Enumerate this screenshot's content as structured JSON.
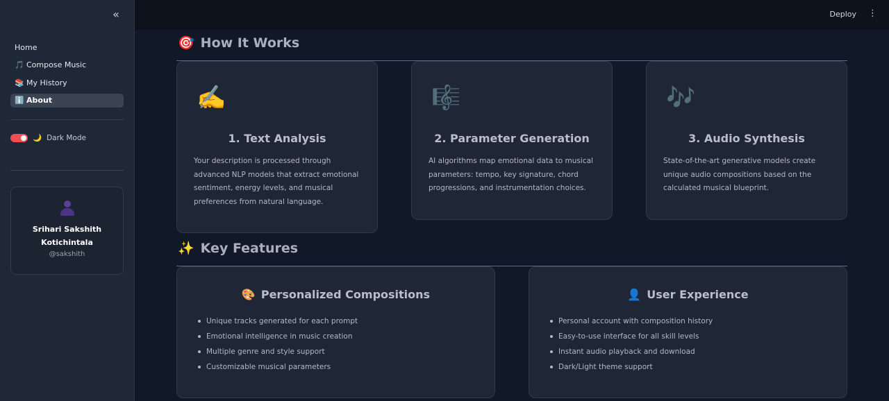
{
  "sidebar": {
    "collapse_icon": "chevrons-left-icon",
    "nav": [
      {
        "label": "Home",
        "icon": ""
      },
      {
        "label": "Compose Music",
        "icon": "🎵"
      },
      {
        "label": "My History",
        "icon": "📚"
      },
      {
        "label": "About",
        "icon": "ℹ️",
        "active": true
      }
    ],
    "dark_mode": {
      "label": "Dark Mode",
      "icon": "🌙",
      "on": true
    },
    "profile": {
      "name_line1": "Srihari Sakshith",
      "name_line2": "Kotichintala",
      "handle": "@sakshith"
    }
  },
  "topbar": {
    "deploy_label": "Deploy",
    "menu_icon": "kebab-icon"
  },
  "how_it_works": {
    "icon": "🎯",
    "title": "How It Works",
    "cards": [
      {
        "icon": "✍️",
        "title": "1. Text Analysis",
        "text": "Your description is processed through advanced NLP models that extract emotional sentiment, energy levels, and musical preferences from natural language."
      },
      {
        "icon": "🎼",
        "title": "2. Parameter Generation",
        "text": "AI algorithms map emotional data to musical parameters: tempo, key signature, chord progressions, and instrumentation choices."
      },
      {
        "icon": "🎶",
        "title": "3. Audio Synthesis",
        "text": "State-of-the-art generative models create unique audio compositions based on the calculated musical blueprint."
      }
    ]
  },
  "key_features": {
    "icon": "✨",
    "title": "Key Features",
    "cards": [
      {
        "icon": "🎨",
        "title": "Personalized Compositions",
        "items": [
          "Unique tracks generated for each prompt",
          "Emotional intelligence in music creation",
          "Multiple genre and style support",
          "Customizable musical parameters"
        ]
      },
      {
        "icon": "👤",
        "title": "User Experience",
        "items": [
          "Personal account with composition history",
          "Easy-to-use interface for all skill levels",
          "Instant audio playback and download",
          "Dark/Light theme support"
        ]
      }
    ]
  },
  "colors": {
    "accent_rule": "#5b5bd6",
    "toggle_on": "#ef4e54",
    "sidebar_bg": "#1f2837",
    "main_bg": "#111827"
  }
}
